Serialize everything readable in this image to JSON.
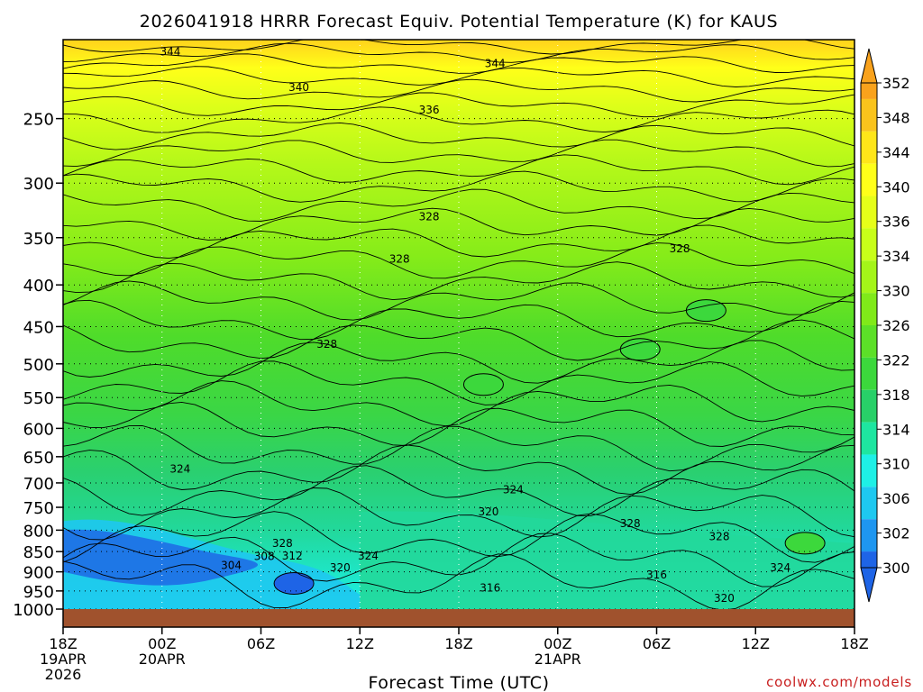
{
  "chart_data": {
    "type": "heatmap",
    "title": "2026041918 HRRR Forecast Equiv. Potential Temperature (K) for KAUS",
    "xlabel": "Forecast Time (UTC)",
    "ylabel": "",
    "credit": "coolwx.com/models",
    "x_ticks": [
      {
        "label": "18Z",
        "sub": [
          "19APR",
          "2026"
        ],
        "hour": 0
      },
      {
        "label": "00Z",
        "sub": [
          "20APR"
        ],
        "hour": 6
      },
      {
        "label": "06Z",
        "sub": [],
        "hour": 12
      },
      {
        "label": "12Z",
        "sub": [],
        "hour": 18
      },
      {
        "label": "18Z",
        "sub": [],
        "hour": 24
      },
      {
        "label": "00Z",
        "sub": [
          "21APR"
        ],
        "hour": 30
      },
      {
        "label": "06Z",
        "sub": [],
        "hour": 36
      },
      {
        "label": "12Z",
        "sub": [],
        "hour": 42
      },
      {
        "label": "18Z",
        "sub": [],
        "hour": 48
      }
    ],
    "x_range_hours": [
      0,
      48
    ],
    "y_axis": "pressure (hPa), log scale, inverted",
    "y_ticks": [
      250,
      300,
      350,
      400,
      450,
      500,
      550,
      600,
      650,
      700,
      750,
      800,
      850,
      900,
      950,
      1000
    ],
    "y_range": [
      200,
      1000
    ],
    "grid": "dotted",
    "surface_fill": "#a0522d",
    "colorbar": {
      "labels": [
        352,
        348,
        344,
        340,
        336,
        334,
        330,
        326,
        322,
        318,
        314,
        310,
        306,
        302,
        300
      ],
      "colors": [
        "#f9a21c",
        "#f9c31c",
        "#ffe619",
        "#ffff19",
        "#e6ff19",
        "#c8ff19",
        "#a4f519",
        "#80ea19",
        "#5ce028",
        "#3cd83c",
        "#28d068",
        "#1ee6a0",
        "#1ef0e6",
        "#1ec8f0",
        "#1e96f0",
        "#1e64e6"
      ]
    },
    "contour_labels": [
      {
        "text": "344",
        "hour": 6.5,
        "p": 207
      },
      {
        "text": "344",
        "hour": 26.2,
        "p": 214
      },
      {
        "text": "340",
        "hour": 14.3,
        "p": 229
      },
      {
        "text": "336",
        "hour": 22.2,
        "p": 244
      },
      {
        "text": "328",
        "hour": 22.2,
        "p": 330
      },
      {
        "text": "328",
        "hour": 20.4,
        "p": 372
      },
      {
        "text": "328",
        "hour": 37.4,
        "p": 361
      },
      {
        "text": "328",
        "hour": 16,
        "p": 473
      },
      {
        "text": "324",
        "hour": 7.1,
        "p": 673
      },
      {
        "text": "324",
        "hour": 27.3,
        "p": 714
      },
      {
        "text": "320",
        "hour": 25.8,
        "p": 760
      },
      {
        "text": "328",
        "hour": 13.3,
        "p": 830
      },
      {
        "text": "328",
        "hour": 34.4,
        "p": 785
      },
      {
        "text": "328",
        "hour": 39.8,
        "p": 815
      },
      {
        "text": "308",
        "hour": 12.2,
        "p": 862
      },
      {
        "text": "312",
        "hour": 13.9,
        "p": 860
      },
      {
        "text": "304",
        "hour": 10.2,
        "p": 884
      },
      {
        "text": "324",
        "hour": 18.5,
        "p": 860
      },
      {
        "text": "320",
        "hour": 16.8,
        "p": 890
      },
      {
        "text": "324",
        "hour": 43.5,
        "p": 890
      },
      {
        "text": "316",
        "hour": 25.9,
        "p": 942
      },
      {
        "text": "316",
        "hour": 36,
        "p": 908
      },
      {
        "text": "320",
        "hour": 40.1,
        "p": 970
      }
    ],
    "closed_contours": [
      {
        "hour": 14,
        "p": 930
      },
      {
        "hour": 25.5,
        "p": 530
      },
      {
        "hour": 35,
        "p": 480
      },
      {
        "hour": 39,
        "p": 430
      },
      {
        "hour": 45,
        "p": 830
      }
    ]
  }
}
